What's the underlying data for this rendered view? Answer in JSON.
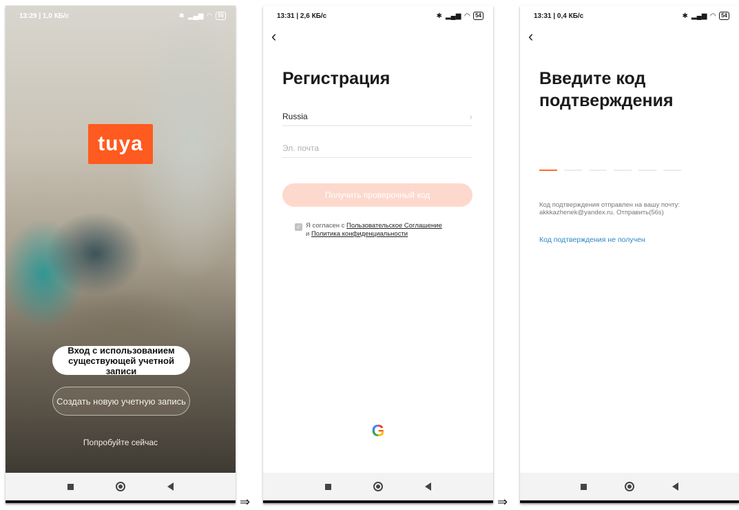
{
  "screen1": {
    "status_time": "13:29 | 1,0 КБ/с",
    "battery": "55",
    "logo_text": "tuya",
    "login_existing_line1": "Вход с использованием",
    "login_existing_line2": "существующей учетной записи",
    "create_new": "Создать новую учетную запись",
    "try_now": "Попробуйте сейчас"
  },
  "screen2": {
    "status_time": "13:31 | 2,6 КБ/с",
    "battery": "54",
    "title": "Регистрация",
    "country": "Russia",
    "email_placeholder": "Эл. почта",
    "get_code": "Получить проверочный код",
    "agree_prefix": "Я согласен с",
    "terms_link": "Пользовательское Соглашение",
    "and": "и",
    "privacy_link": "Политика конфиденциальности"
  },
  "screen3": {
    "status_time": "13:31 | 0,4 КБ/с",
    "battery": "54",
    "title_line1": "Введите код",
    "title_line2": "подтверждения",
    "sent_line1": "Код подтверждения отправлен на вашу почту:",
    "sent_line2": "akkkazhenek@yandex.ru. Отправить(56s)",
    "not_received": "Код подтверждения не получен"
  },
  "colors": {
    "brand_orange": "#ff5a1f",
    "button_disabled": "#fdd9cd",
    "link_blue": "#2a87c4"
  }
}
